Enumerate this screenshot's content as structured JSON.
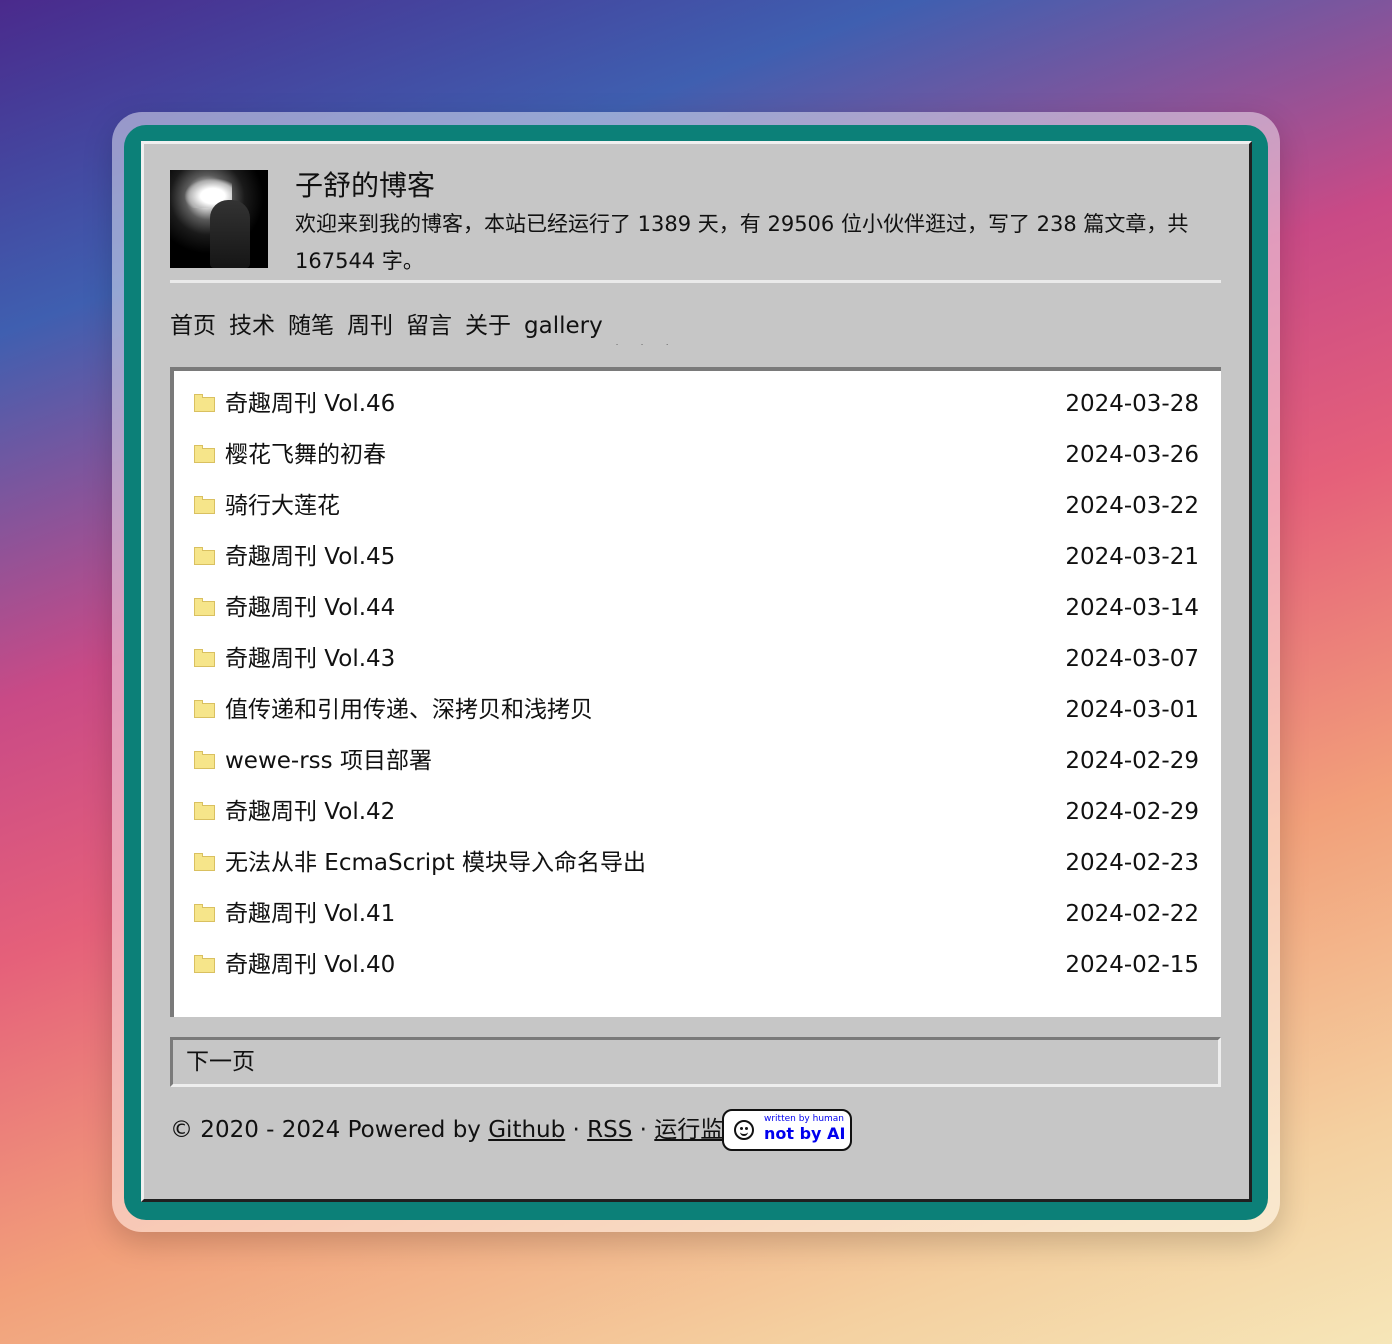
{
  "header": {
    "title": "子舒的博客",
    "description": "欢迎来到我的博客，本站已经运行了 1389 天，有 29506 位小伙伴逛过，写了 238 篇文章，共 167544 字。"
  },
  "nav": {
    "items": [
      "首页",
      "技术",
      "随笔",
      "周刊",
      "留言",
      "关于",
      "gallery"
    ],
    "dots": ". . ."
  },
  "posts": [
    {
      "title": "奇趣周刊 Vol.46",
      "date": "2024-03-28"
    },
    {
      "title": "樱花飞舞的初春",
      "date": "2024-03-26"
    },
    {
      "title": "骑行大莲花",
      "date": "2024-03-22"
    },
    {
      "title": "奇趣周刊 Vol.45",
      "date": "2024-03-21"
    },
    {
      "title": "奇趣周刊 Vol.44",
      "date": "2024-03-14"
    },
    {
      "title": "奇趣周刊 Vol.43",
      "date": "2024-03-07"
    },
    {
      "title": "值传递和引用传递、深拷贝和浅拷贝",
      "date": "2024-03-01"
    },
    {
      "title": "wewe-rss 项目部署",
      "date": "2024-02-29"
    },
    {
      "title": "奇趣周刊 Vol.42",
      "date": "2024-02-29"
    },
    {
      "title": "无法从非 EcmaScript 模块导入命名导出",
      "date": "2024-02-23"
    },
    {
      "title": "奇趣周刊 Vol.41",
      "date": "2024-02-22"
    },
    {
      "title": "奇趣周刊 Vol.40",
      "date": "2024-02-15"
    }
  ],
  "pagination": {
    "next_label": "下一页"
  },
  "footer": {
    "prefix": "© 2020 - 2024 Powered by ",
    "github": "Github",
    "sep1": " · ",
    "rss": "RSS",
    "sep2": " · ",
    "monitor": "运行监控"
  },
  "badge": {
    "small": "written by human",
    "big": "not by AI"
  },
  "icons": {
    "post_icon": "folder-icon",
    "badge_icon": "smile-icon"
  },
  "colors": {
    "accent_frame": "#0c8078",
    "panel": "#c6c6c6",
    "folder": "#f6e58a"
  }
}
